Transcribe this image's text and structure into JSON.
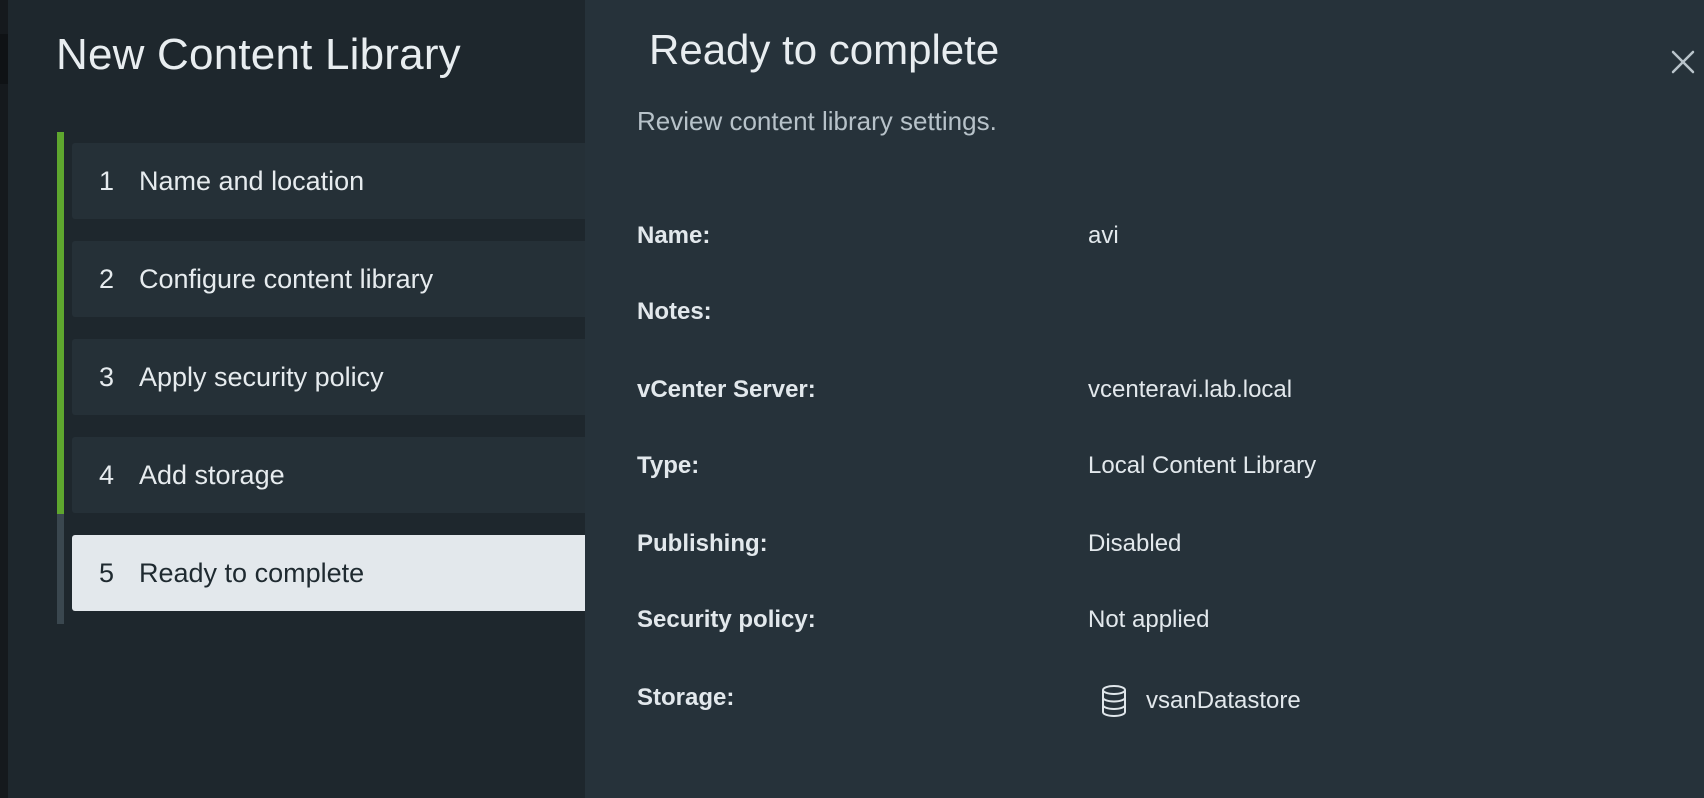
{
  "wizard": {
    "title": "New Content Library",
    "steps": [
      {
        "number": "1",
        "label": "Name and location",
        "state": "complete"
      },
      {
        "number": "2",
        "label": "Configure content library",
        "state": "complete"
      },
      {
        "number": "3",
        "label": "Apply security policy",
        "state": "complete"
      },
      {
        "number": "4",
        "label": "Add storage",
        "state": "complete"
      },
      {
        "number": "5",
        "label": "Ready to complete",
        "state": "active"
      }
    ]
  },
  "page": {
    "title": "Ready to complete",
    "subtitle": "Review content library settings.",
    "close_icon": "close-icon"
  },
  "summary": {
    "name": {
      "label": "Name:",
      "value": "avi"
    },
    "notes": {
      "label": "Notes:",
      "value": ""
    },
    "vcenter": {
      "label": "vCenter Server:",
      "value": "vcenteravi.lab.local"
    },
    "type": {
      "label": "Type:",
      "value": "Local Content Library"
    },
    "publishing": {
      "label": "Publishing:",
      "value": "Disabled"
    },
    "security_policy": {
      "label": "Security policy:",
      "value": "Not applied"
    },
    "storage": {
      "label": "Storage:",
      "value": "vsanDatastore",
      "icon": "datastore-icon"
    }
  },
  "colors": {
    "progress_complete": "#5ea62e",
    "active_step_bg": "#e3e8ec",
    "panel_bg": "#26323a"
  }
}
